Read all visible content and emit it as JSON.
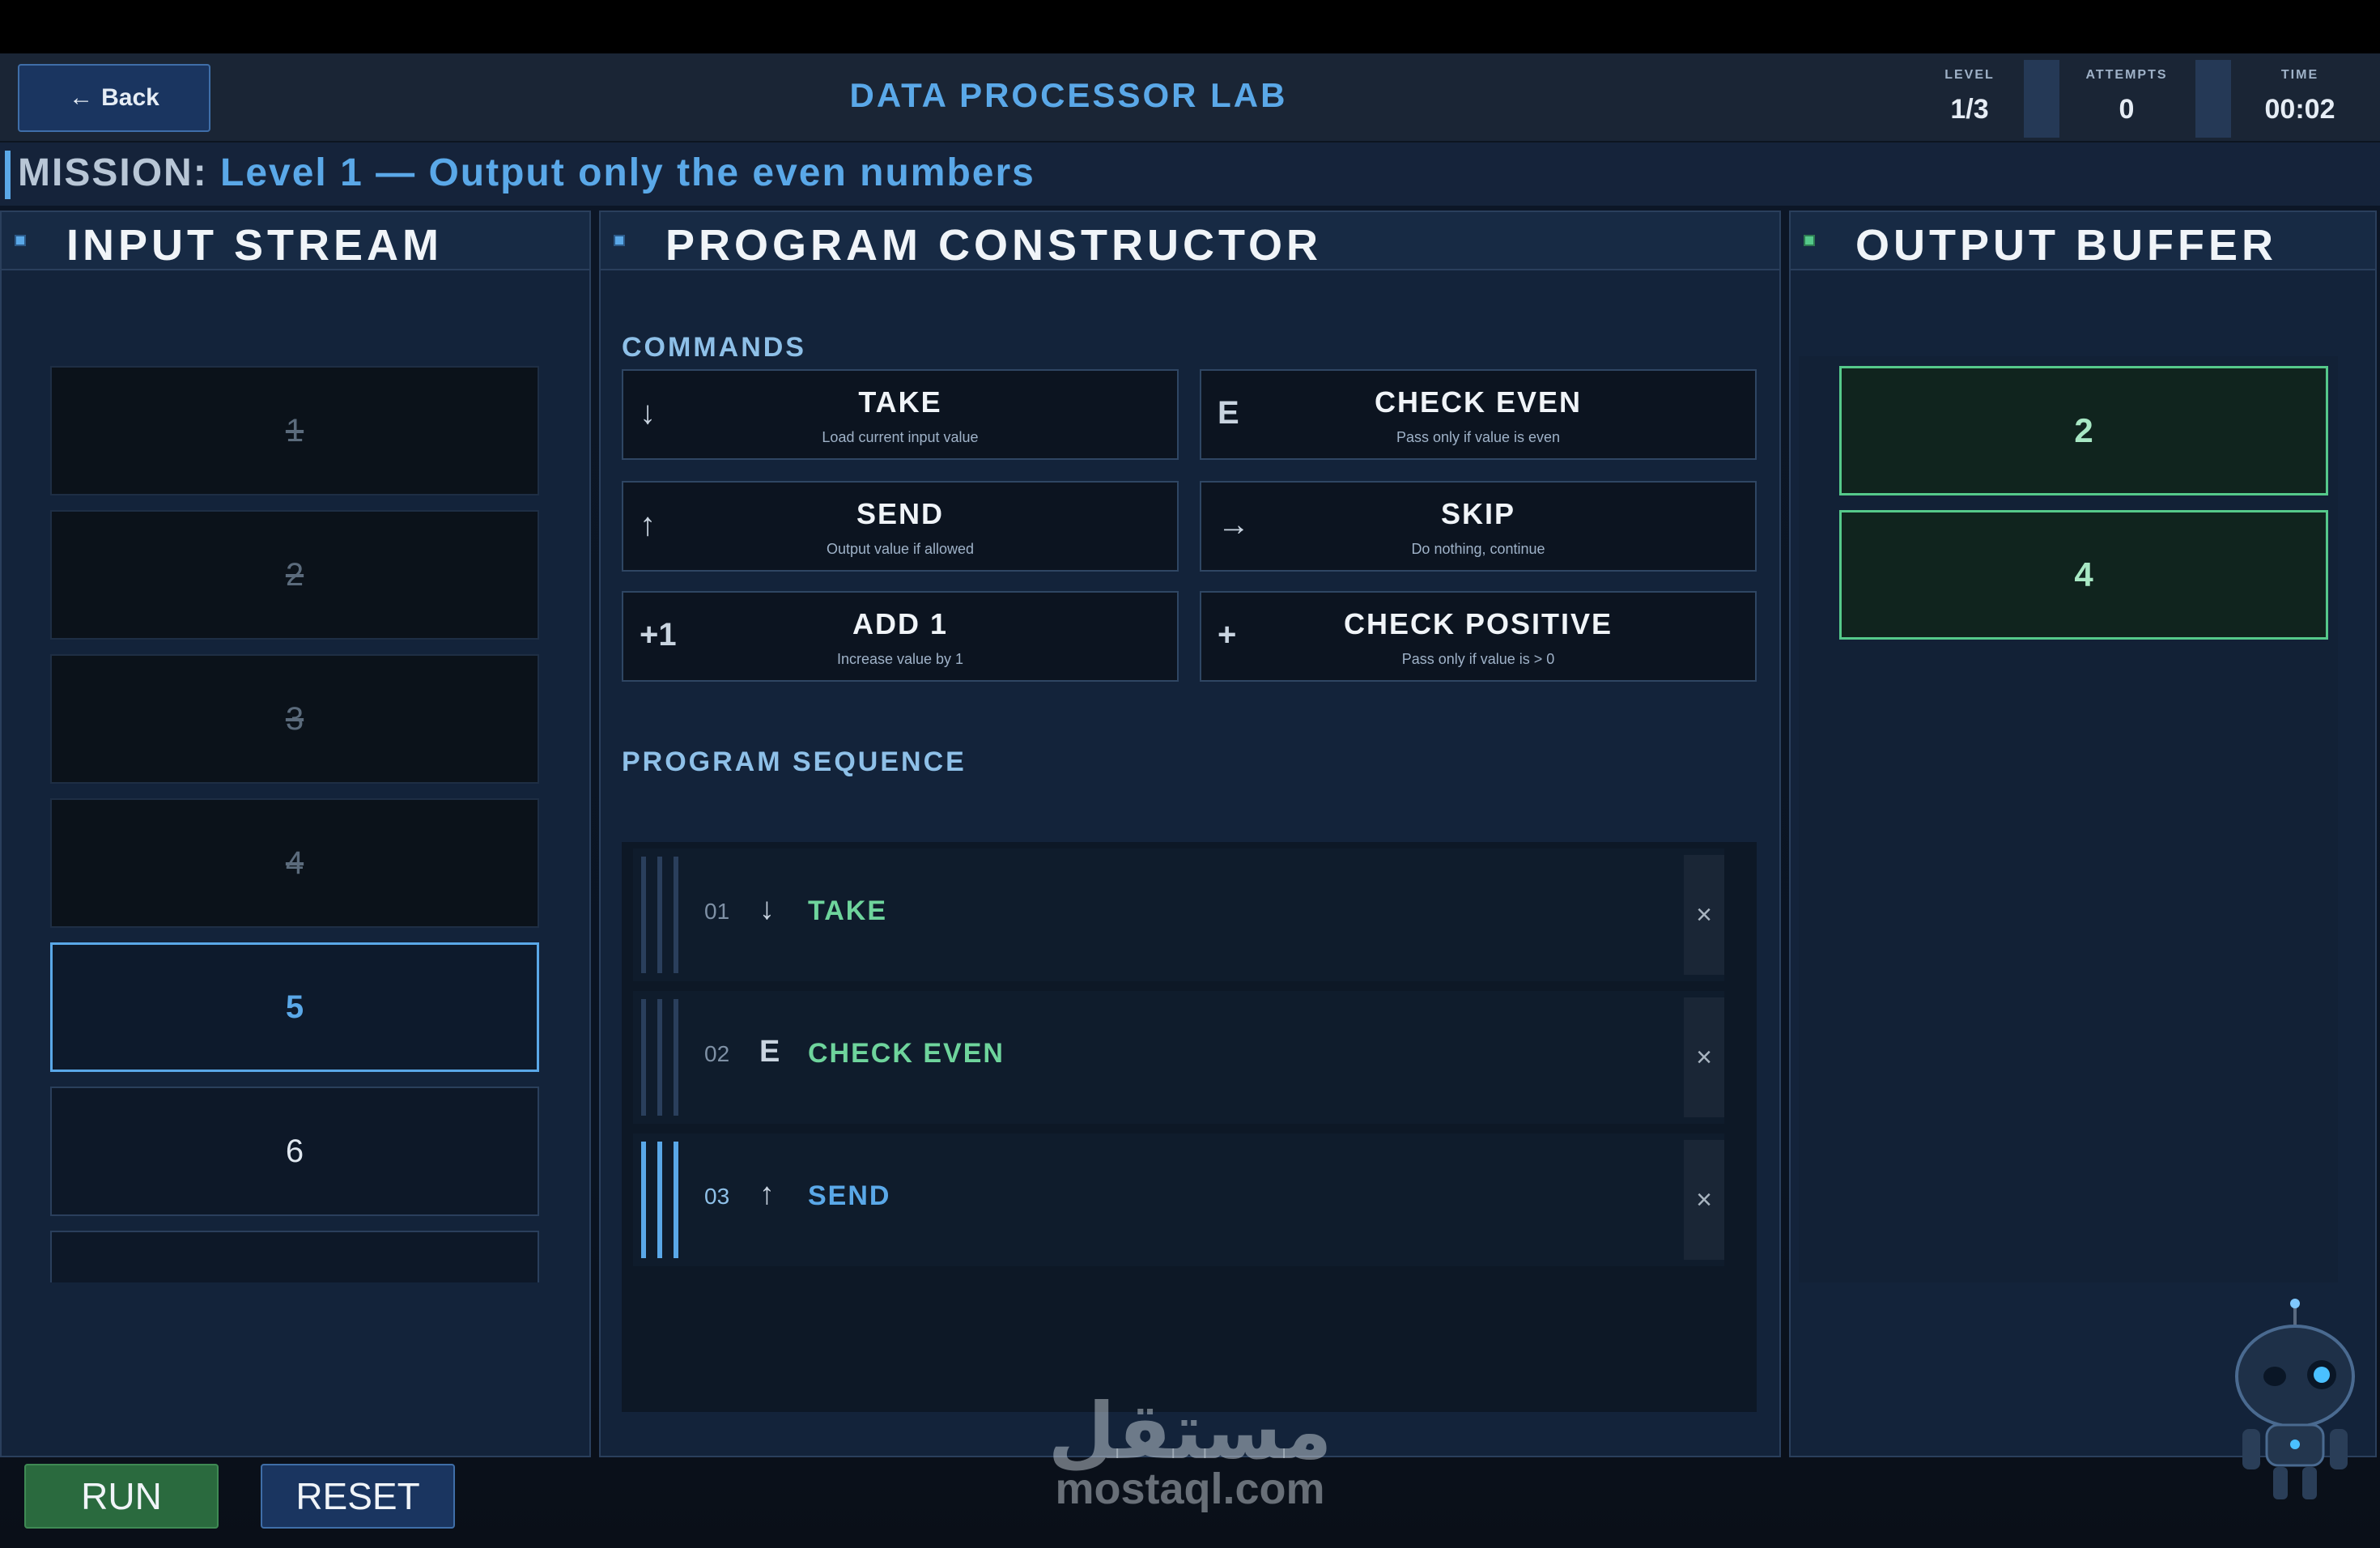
{
  "header": {
    "back_icon": "←",
    "back_label": "Back",
    "title": "DATA PROCESSOR LAB",
    "stats": [
      {
        "label": "LEVEL",
        "value": "1/3"
      },
      {
        "label": "ATTEMPTS",
        "value": "0"
      },
      {
        "label": "TIME",
        "value": "00:02"
      }
    ]
  },
  "mission": {
    "prefix": "MISSION:",
    "text": "Level 1 — Output only the even numbers"
  },
  "input_stream": {
    "title": "INPUT STREAM",
    "items": [
      {
        "value": "1",
        "state": "done"
      },
      {
        "value": "2",
        "state": "done"
      },
      {
        "value": "3",
        "state": "done"
      },
      {
        "value": "4",
        "state": "done"
      },
      {
        "value": "5",
        "state": "active"
      },
      {
        "value": "6",
        "state": "next"
      }
    ]
  },
  "constructor": {
    "title": "PROGRAM CONSTRUCTOR",
    "commands_label": "COMMANDS",
    "commands": [
      {
        "icon": "↓",
        "name": "TAKE",
        "desc": "Load current input value"
      },
      {
        "icon": "E",
        "name": "CHECK EVEN",
        "desc": "Pass only if value is even"
      },
      {
        "icon": "↑",
        "name": "SEND",
        "desc": "Output value if allowed"
      },
      {
        "icon": "→",
        "name": "SKIP",
        "desc": "Do nothing, continue"
      },
      {
        "icon": "+1",
        "name": "ADD 1",
        "desc": "Increase value by 1"
      },
      {
        "icon": "+",
        "name": "CHECK POSITIVE",
        "desc": "Pass only if value is > 0"
      }
    ],
    "sequence_label": "PROGRAM SEQUENCE",
    "sequence": [
      {
        "num": "01",
        "icon": "↓",
        "name": "TAKE",
        "delete": "×"
      },
      {
        "num": "02",
        "icon": "E",
        "name": "CHECK EVEN",
        "delete": "×"
      },
      {
        "num": "03",
        "icon": "↑",
        "name": "SEND",
        "delete": "×"
      }
    ]
  },
  "output_buffer": {
    "title": "OUTPUT BUFFER",
    "items": [
      "2",
      "4"
    ]
  },
  "controls": {
    "run_label": "RUN",
    "reset_label": "RESET"
  },
  "watermark": {
    "arabic": "مستقل",
    "latin": "mostaql.com"
  },
  "colors": {
    "accent": "#5aa8e8",
    "success": "#55c98a",
    "panel": "#13233a"
  }
}
